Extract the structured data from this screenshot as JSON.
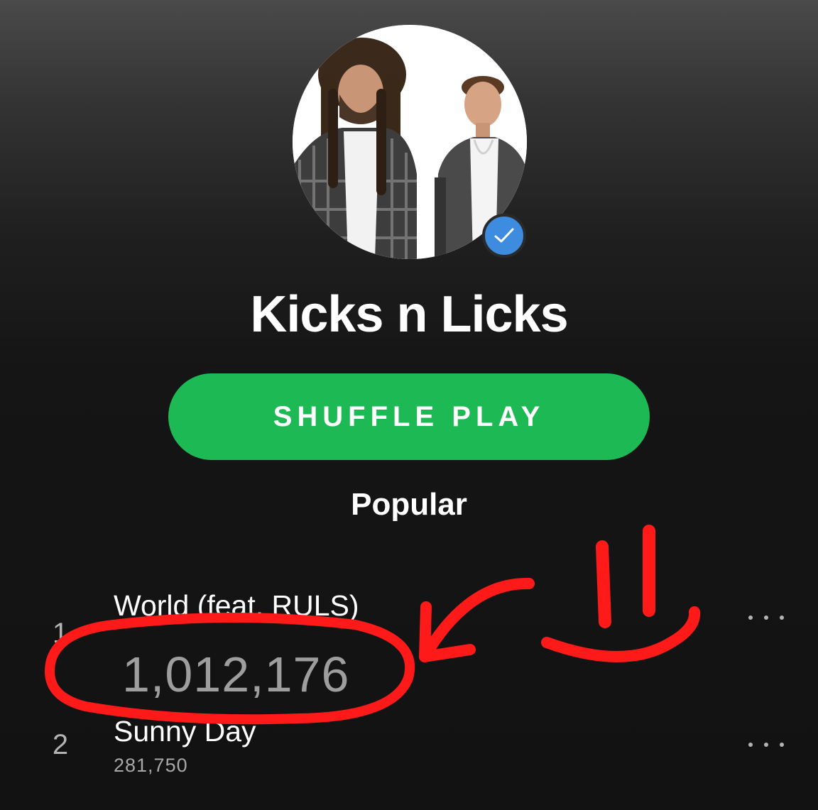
{
  "artist": {
    "name": "Kicks n Licks",
    "verified": true
  },
  "actions": {
    "shuffle_label": "SHUFFLE PLAY"
  },
  "popular": {
    "title": "Popular",
    "tracks": [
      {
        "rank": "1",
        "title": "World (feat. RULS)",
        "plays": "1,012,176"
      },
      {
        "rank": "2",
        "title": "Sunny Day",
        "plays": "281,750"
      }
    ]
  },
  "colors": {
    "accent_green": "#1db954",
    "verified_blue": "#3d8ce0",
    "annotation_red": "#ff1a1a",
    "background": "#121212"
  },
  "icons": {
    "verified": "check-icon",
    "more": "ellipsis-icon"
  }
}
